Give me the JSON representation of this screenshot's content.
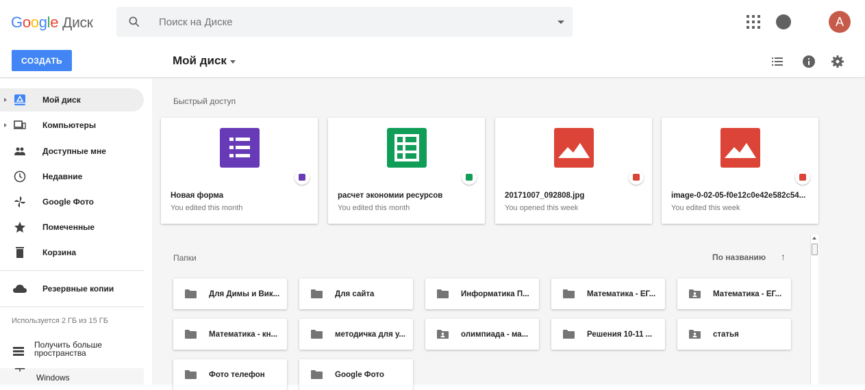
{
  "app": {
    "logo_google": [
      "G",
      "o",
      "o",
      "g",
      "l",
      "e"
    ],
    "logo_product": "Диск"
  },
  "search": {
    "placeholder": "Поиск на Диске"
  },
  "header": {
    "avatar_letter": "A"
  },
  "toolbar": {
    "create_label": "СОЗДАТЬ",
    "title": "Мой диск"
  },
  "sidebar": {
    "items": [
      {
        "label": "Мой диск",
        "icon": "drive-icon"
      },
      {
        "label": "Компьютеры",
        "icon": "computers-icon"
      },
      {
        "label": "Доступные мне",
        "icon": "shared-icon"
      },
      {
        "label": "Недавние",
        "icon": "clock-icon"
      },
      {
        "label": "Google Фото",
        "icon": "photos-icon"
      },
      {
        "label": "Помеченные",
        "icon": "star-icon"
      },
      {
        "label": "Корзина",
        "icon": "trash-icon"
      }
    ],
    "backup_label": "Резервные копии",
    "storage_text": "Используется 2 ГБ из 15 ГБ",
    "upgrade_label": "Получить больше пространства",
    "windows_label": "Windows"
  },
  "quick_access": {
    "title": "Быстрый доступ",
    "cards": [
      {
        "name": "Новая форма",
        "sub": "You edited this month",
        "type": "form",
        "color": "#673ab7"
      },
      {
        "name": "расчет экономии ресурсов",
        "sub": "You edited this month",
        "type": "sheet",
        "color": "#0f9d58"
      },
      {
        "name": "20171007_092808.jpg",
        "sub": "You opened this week",
        "type": "image",
        "color": "#db4437"
      },
      {
        "name": "image-0-02-05-f0e12c0e42e582c54...",
        "sub": "You edited this week",
        "type": "image",
        "color": "#db4437"
      }
    ]
  },
  "folders": {
    "title": "Папки",
    "sort_label": "По названию",
    "items": [
      {
        "name": "Для Димы и Вик...",
        "shared": false
      },
      {
        "name": "Для сайта",
        "shared": false
      },
      {
        "name": "Информатика П...",
        "shared": false
      },
      {
        "name": "Математика - ЕГ...",
        "shared": false
      },
      {
        "name": "Математика - ЕГ...",
        "shared": true
      },
      {
        "name": "Математика - кн...",
        "shared": false
      },
      {
        "name": "методичка для у...",
        "shared": false
      },
      {
        "name": "олимпиада - ма...",
        "shared": true
      },
      {
        "name": "Решения 10-11 ...",
        "shared": false
      },
      {
        "name": "статья",
        "shared": true
      },
      {
        "name": "Фото телефон",
        "shared": false
      },
      {
        "name": "Google Фото",
        "shared": false
      }
    ]
  },
  "colors": {
    "accent": "#4285f4",
    "avatar": "#c75b4a",
    "form": "#673ab7",
    "sheet": "#0f9d58",
    "image": "#db4437"
  }
}
